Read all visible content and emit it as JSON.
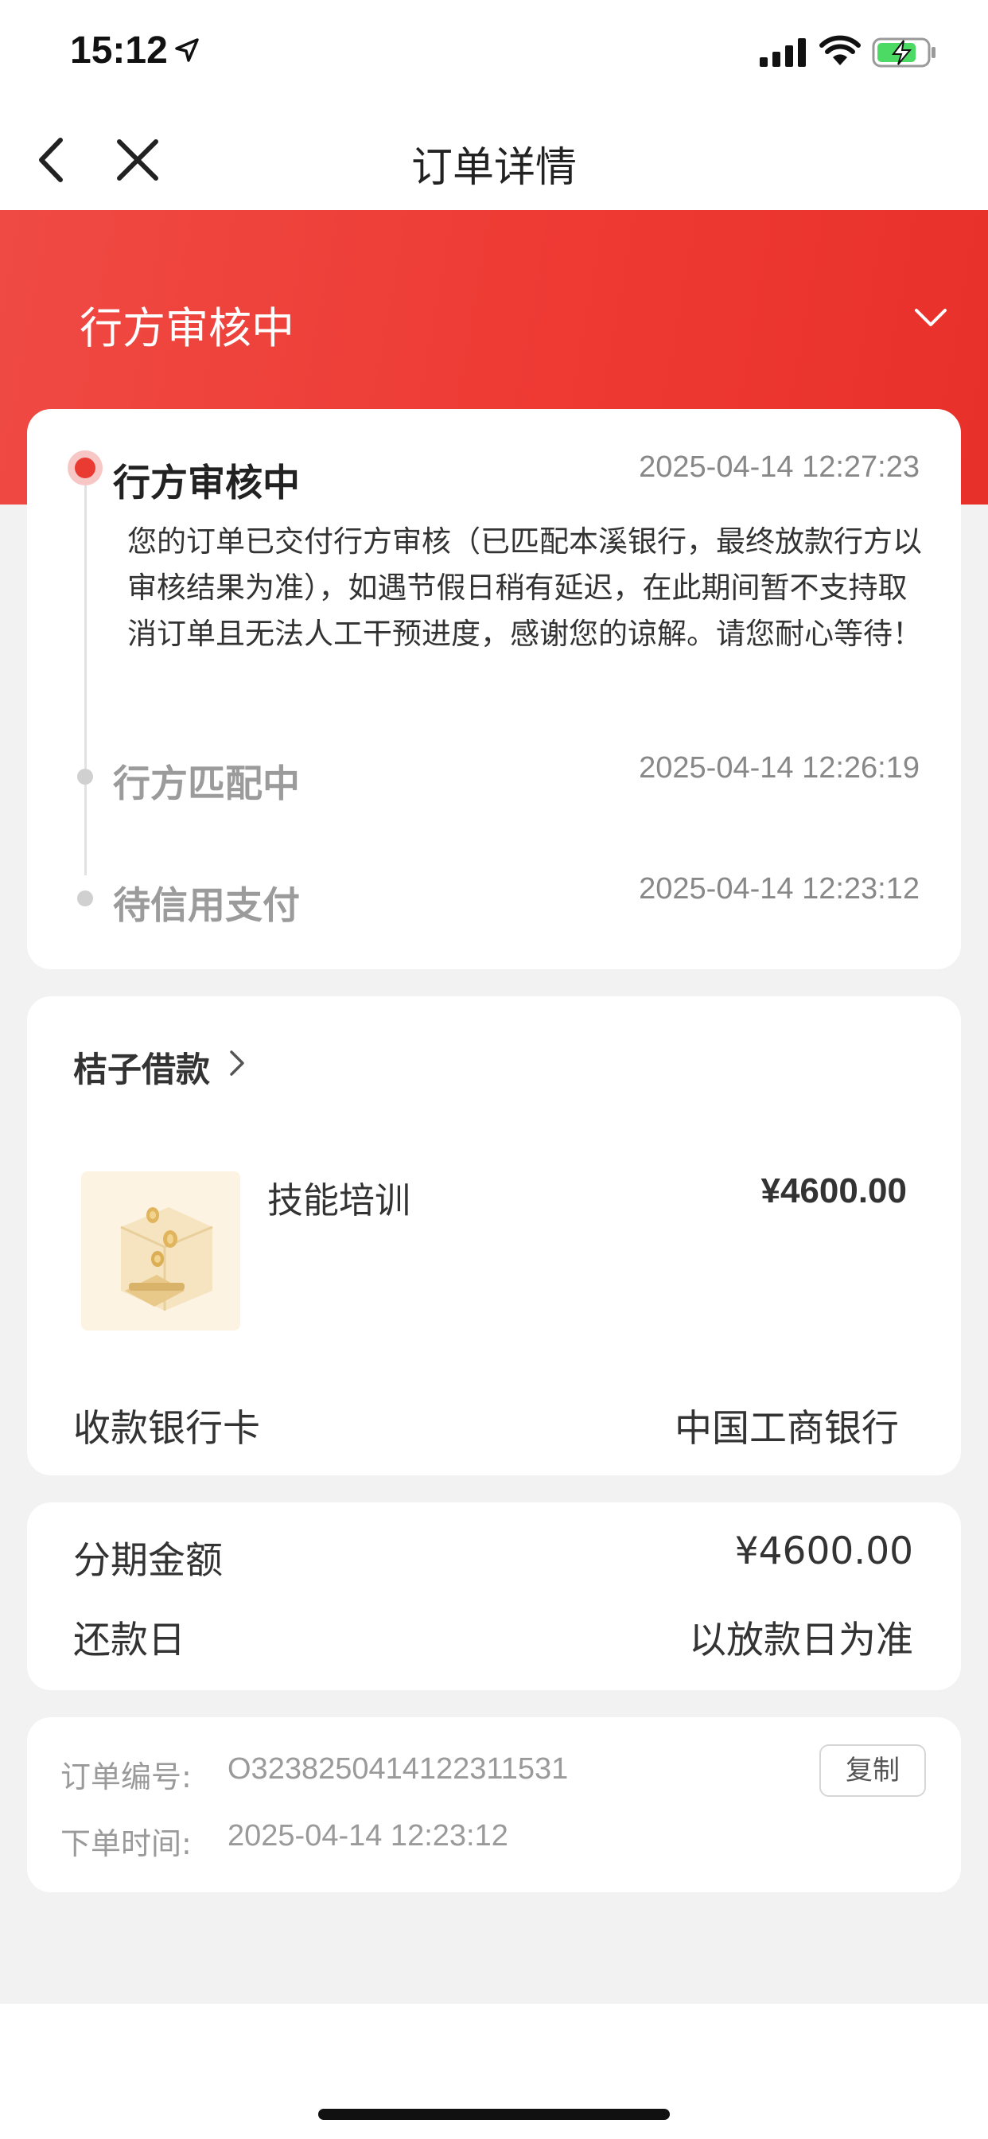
{
  "status_bar": {
    "time": "15:12"
  },
  "nav": {
    "title": "订单详情"
  },
  "banner": {
    "status_title": "行方审核中"
  },
  "timeline": {
    "items": [
      {
        "title": "行方审核中",
        "time": "2025-04-14 12:27:23",
        "description": "您的订单已交付行方审核（已匹配本溪银行，最终放款行方以审核结果为准），如遇节假日稍有延迟，在此期间暂不支持取消订单且无法人工干预进度，感谢您的谅解。请您耐心等待！"
      },
      {
        "title": "行方匹配中",
        "time": "2025-04-14 12:26:19"
      },
      {
        "title": "待信用支付",
        "time": "2025-04-14 12:23:12"
      }
    ]
  },
  "merchant": {
    "name": "桔子借款",
    "product_name": "技能培训",
    "product_price": "¥4600.00",
    "bank_label": "收款银行卡",
    "bank_value": "中国工商银行"
  },
  "installment": {
    "amount_label": "分期金额",
    "amount_value": "¥4600.00",
    "repay_label": "还款日",
    "repay_value": "以放款日为准"
  },
  "order_info": {
    "order_no_label": "订单编号:",
    "order_no_value": "O32382504141223115​31",
    "copy_label": "复制",
    "order_time_label": "下单时间:",
    "order_time_value": "2025-04-14 12:23:12"
  },
  "colors": {
    "accent": "#ea3b32",
    "page_bg": "#f2f2f2"
  }
}
